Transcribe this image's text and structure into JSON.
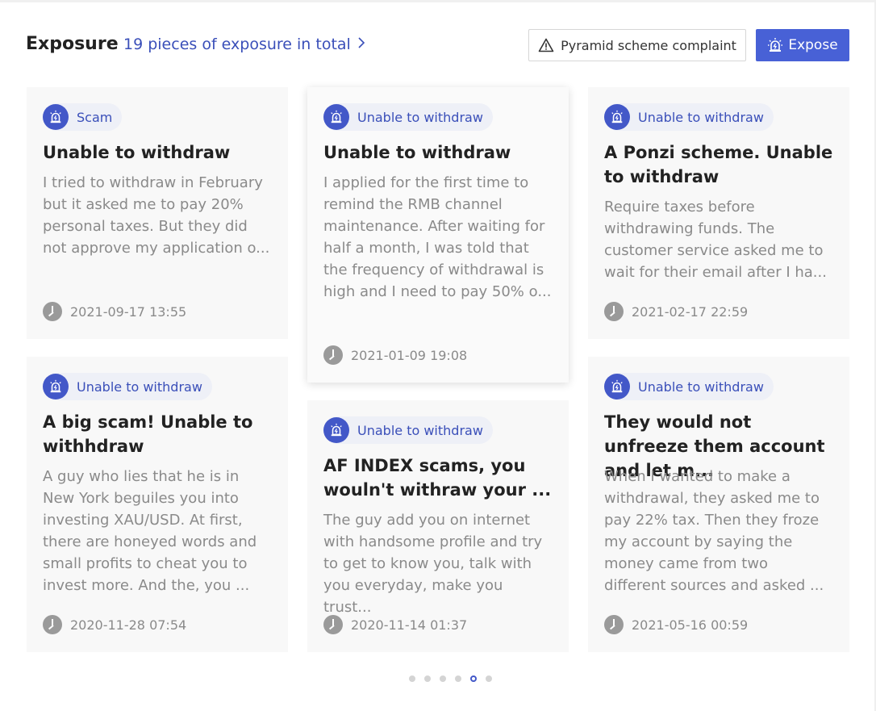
{
  "header": {
    "title": "Exposure",
    "total_link": "19 pieces of exposure in total",
    "complaint_button": "Pyramid scheme complaint",
    "expose_button": "Expose"
  },
  "cards": [
    {
      "tag": "Scam",
      "title": "Unable to withdraw",
      "body": "I tried to withdraw in February but it asked me to pay 20% personal taxes. But they did not approve my application o...",
      "time": "2021-09-17 13:55"
    },
    {
      "tag": "Unable to withdraw",
      "title": "Unable to withdraw",
      "body": "I applied for the first time to remind the RMB channel maintenance. After waiting for half a month, I was told that the frequency of withdrawal is high and I need to pay 50% o...",
      "time": "2021-01-09 19:08"
    },
    {
      "tag": "Unable to withdraw",
      "title": "A Ponzi scheme. Unable to withdraw",
      "body": "Require taxes before withdrawing funds. The customer service asked me to wait for their email after I ha...",
      "time": "2021-02-17 22:59"
    },
    {
      "tag": "Unable to withdraw",
      "title": "A big scam! Unable to withhdraw",
      "body": "A guy who lies that he is in New York beguiles you into investing XAU/USD. At first, there are honeyed words and small profits to cheat you to invest more. And the, you ...",
      "time": "2020-11-28 07:54"
    },
    {
      "tag": "Unable to withdraw",
      "title": "AF INDEX scams, you wouln't withraw your ...",
      "body": "The guy add you on internet with handsome profile and try to get to know you, talk with you everyday, make you trust...",
      "time": "2020-11-14 01:37"
    },
    {
      "tag": "Unable to withdraw",
      "title": "They would not unfreeze them account and let m...",
      "body": "When I wanted to make a withdrawal, they asked me to pay 22% tax. Then they froze my account by saying the money came from two different sources and asked ...",
      "time": "2021-05-16 00:59"
    }
  ],
  "pagination": {
    "total": 6,
    "active_index": 4
  },
  "colors": {
    "accent": "#4861d6",
    "tag_text": "#3a4fb9",
    "tag_bg": "#eef0f7",
    "muted": "#8a8a8a"
  }
}
